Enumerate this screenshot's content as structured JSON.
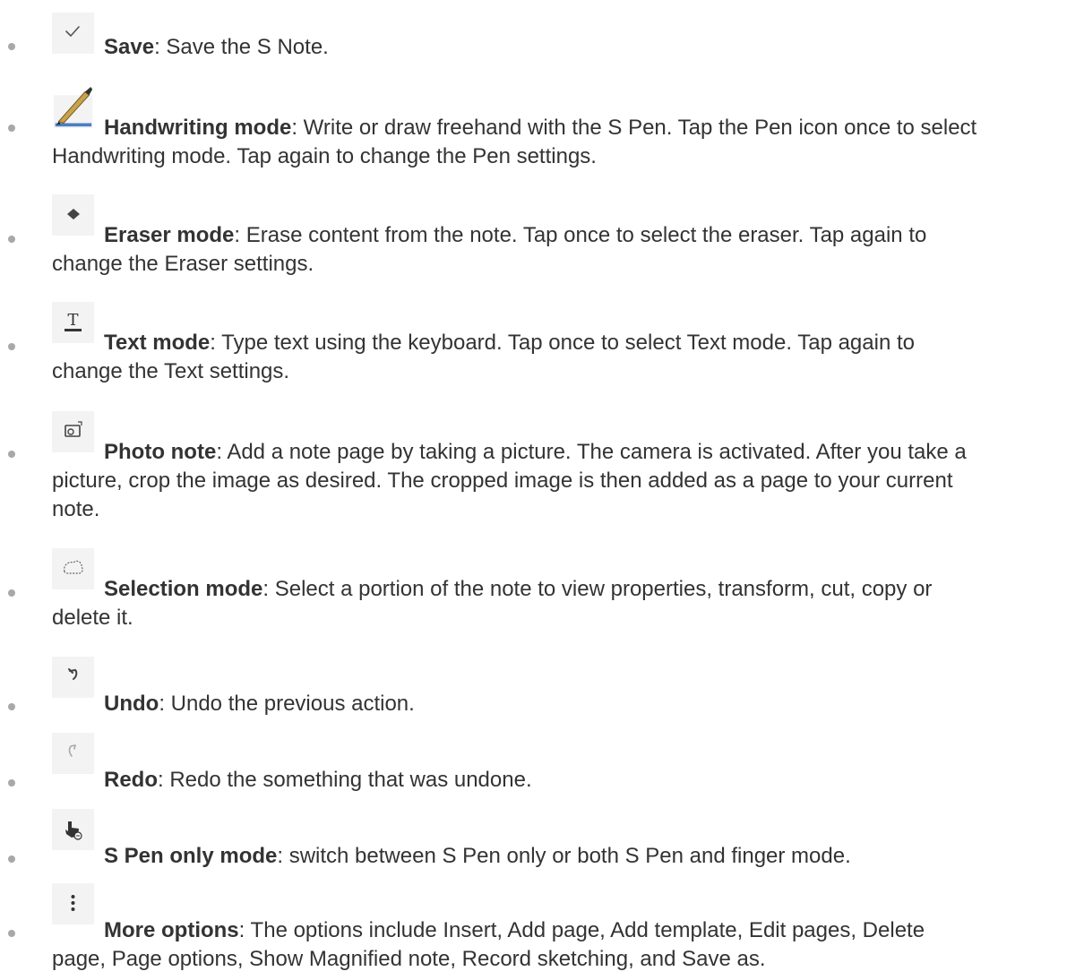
{
  "items": [
    {
      "icon": "checkmark-icon",
      "term": "Save",
      "desc_line1": ": Save the S Note.",
      "desc_more": []
    },
    {
      "icon": "pen-icon",
      "term": "Handwriting mode",
      "desc_line1": ": Write or draw freehand with the S Pen. Tap the Pen icon once to select",
      "desc_more": [
        "Handwriting mode. Tap again to change the Pen settings."
      ]
    },
    {
      "icon": "eraser-icon",
      "term": "Eraser mode",
      "desc_line1": ": Erase content from the note. Tap once to select the eraser. Tap again to",
      "desc_more": [
        "change the Eraser settings."
      ]
    },
    {
      "icon": "text-icon",
      "term": "Text mode",
      "desc_line1": ": Type text using the keyboard. Tap once to select Text mode. Tap again to",
      "desc_more": [
        "change the Text settings."
      ]
    },
    {
      "icon": "camera-icon",
      "term": "Photo note",
      "desc_line1": ": Add a note page by taking a picture. The camera is activated. After you take a",
      "desc_more": [
        "picture, crop the image as desired. The cropped image is then added as a page to your current",
        "note."
      ]
    },
    {
      "icon": "lasso-icon",
      "term": "Selection mode",
      "desc_line1": ": Select a portion of the note to view properties, transform, cut, copy or",
      "desc_more": [
        "delete it."
      ]
    },
    {
      "icon": "undo-icon",
      "term": "Undo",
      "desc_line1": ": Undo the previous action.",
      "desc_more": []
    },
    {
      "icon": "redo-icon",
      "term": "Redo",
      "desc_line1": ": Redo the something that was undone.",
      "desc_more": []
    },
    {
      "icon": "pen-only-icon",
      "term": "S Pen only mode",
      "desc_line1": ": switch between S Pen only or both S Pen and finger mode.",
      "desc_more": []
    },
    {
      "icon": "more-options-icon",
      "term": "More options",
      "desc_line1": ": The options include Insert, Add page, Add template, Edit pages, Delete",
      "desc_more": [
        "page, Page options, Show Magnified note, Record sketching, and Save as."
      ]
    }
  ]
}
